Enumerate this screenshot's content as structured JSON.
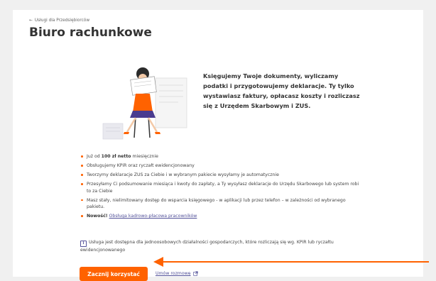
{
  "breadcrumb": {
    "back_label": "Usługi dla Przedsiębiorców"
  },
  "page": {
    "title": "Biuro rachunkowe"
  },
  "intro": {
    "text": "Księgujemy Twoje dokumenty, wyliczamy podatki i przygotowujemy deklaracje. Ty tylko wystawiasz faktury, opłacasz koszty i rozliczasz się z Urzędem Skarbowym i ZUS."
  },
  "features": {
    "price_prefix": "Już od",
    "price_value": "100 zł netto",
    "price_suffix": "miesięcznie",
    "items": [
      "Obsługujemy KPiR oraz ryczałt ewidencjonowany",
      "Tworzymy deklaracje ZUS za Ciebie i w wybranym pakiecie wysyłamy je automatycznie",
      "Przesyłamy Ci podsumowanie miesiąca i kwoty do zapłaty, a Ty wysyłasz deklaracje do Urzędu Skarbowego lub system robi to za Ciebie",
      "Masz stały, nielimitowany dostęp do wsparcia księgowego - w aplikacji lub przez telefon – w zależności od wybranego pakietu."
    ],
    "new_label": "Nowość!",
    "new_link": "Obsługa kadrowo-płacowa pracowników"
  },
  "info": {
    "icon": "i",
    "text": "Usługa jest dostępna dla jednoosobowych działalności gospodarczych, które rozliczają się wg. KPiR lub ryczałtu ewidencjonowanego"
  },
  "actions": {
    "primary_label": "Zacznij korzystać",
    "secondary_label": "Umów rozmowę"
  },
  "colors": {
    "accent": "#ff6200",
    "link": "#525199",
    "background": "#f0f0f0"
  },
  "icons": {
    "back": "arrow-left-icon",
    "info": "info-icon",
    "external": "external-link-icon"
  }
}
